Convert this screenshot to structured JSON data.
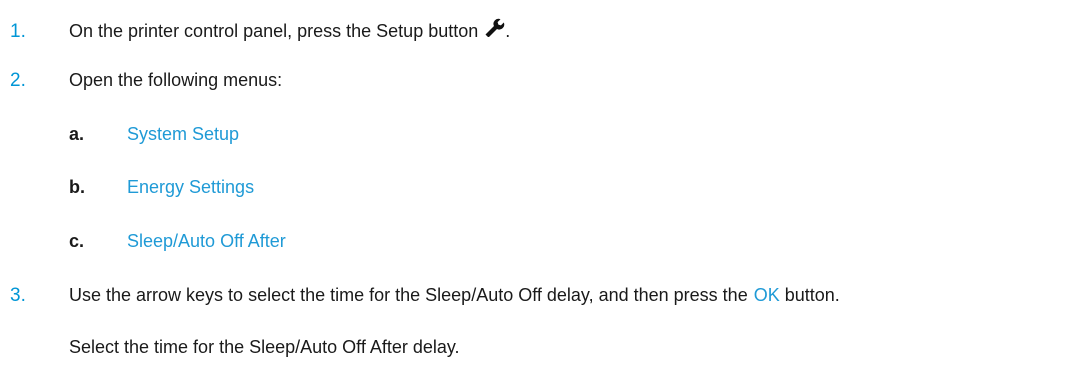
{
  "steps": [
    {
      "number": "1.",
      "text_before": "On the printer control panel, press the Setup button",
      "icon": "wrench-icon",
      "text_after": "."
    },
    {
      "number": "2.",
      "text": "Open the following menus:",
      "substeps": [
        {
          "letter": "a.",
          "label": "System Setup"
        },
        {
          "letter": "b.",
          "label": "Energy Settings"
        },
        {
          "letter": "c.",
          "label": "Sleep/Auto Off After"
        }
      ]
    },
    {
      "number": "3.",
      "text_before": "Use the arrow keys to select the time for the Sleep/Auto Off delay, and then press the",
      "ok_label": "OK",
      "text_after": "button.",
      "note": "Select the time for the Sleep/Auto Off After delay."
    }
  ],
  "colors": {
    "accent": "#0096d6",
    "link": "#1f9ad6",
    "text": "#1a1a1a"
  }
}
